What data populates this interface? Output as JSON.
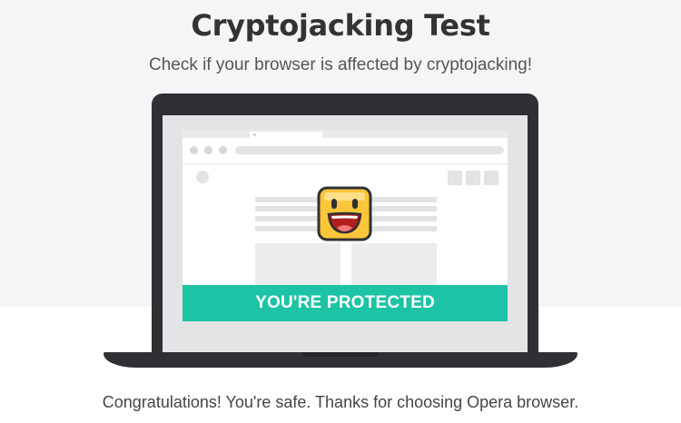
{
  "header": {
    "title": "Cryptojacking Test",
    "subtitle": "Check if your browser is affected by cryptojacking!"
  },
  "illustration": {
    "status_banner": "YOU'RE PROTECTED",
    "mascot_icon": "happy-face-icon",
    "colors": {
      "banner": "#1cc3a5",
      "mascot_face": "#fcc63a",
      "laptop": "#2f3033"
    }
  },
  "footer": {
    "message": "Congratulations! You're safe. Thanks for choosing Opera browser."
  }
}
